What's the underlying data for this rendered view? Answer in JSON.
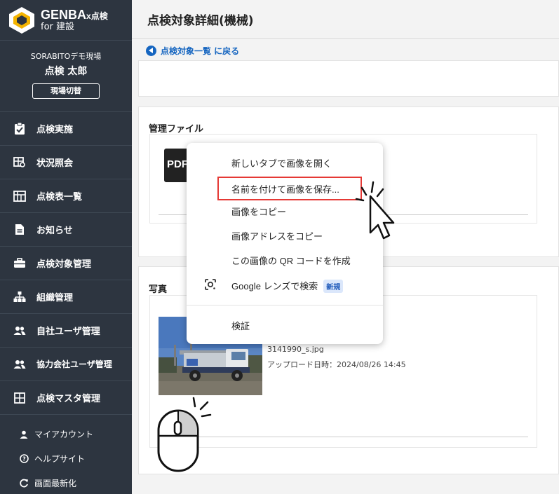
{
  "sidebar": {
    "brand_main": "GENBA",
    "brand_x": "x点検",
    "brand_sub": "for 建設",
    "site_name": "SORABITOデモ現場",
    "user_name": "点検 太郎",
    "switch_label": "現場切替",
    "nav": [
      {
        "label": "点検実施",
        "icon": "clipboard-check-icon"
      },
      {
        "label": "状況照会",
        "icon": "table-search-icon"
      },
      {
        "label": "点検表一覧",
        "icon": "table-list-icon"
      },
      {
        "label": "お知らせ",
        "icon": "document-icon"
      },
      {
        "label": "点検対象管理",
        "icon": "toolbox-icon"
      },
      {
        "label": "組織管理",
        "icon": "org-chart-icon"
      },
      {
        "label": "自社ユーザ管理",
        "icon": "users-icon"
      },
      {
        "label": "協力会社ユーザ管理",
        "icon": "users-icon"
      },
      {
        "label": "点検マスタ管理",
        "icon": "grid-icon"
      }
    ],
    "bottom": [
      {
        "label": "マイアカウント",
        "icon": "person-icon"
      },
      {
        "label": "ヘルプサイト",
        "icon": "help-circle-icon"
      },
      {
        "label": "画面最新化",
        "icon": "refresh-icon"
      }
    ]
  },
  "header": {
    "title": "点検対象詳細(機械)",
    "back_label": "点検対象一覧 に戻る"
  },
  "files": {
    "title": "管理ファイル",
    "pdf_label": "PDF"
  },
  "photos": {
    "title": "写真",
    "file_name": "3141990_s.jpg",
    "upload_date": "アップロード日時：2024/08/26 14:45"
  },
  "context_menu": {
    "items": [
      "新しいタブで画像を開く",
      "名前を付けて画像を保存...",
      "画像をコピー",
      "画像アドレスをコピー",
      "この画像の QR コードを作成",
      "Google レンズで検索"
    ],
    "badge": "新規",
    "inspect": "検証"
  },
  "colors": {
    "sidebar_bg": "#2d3540",
    "link": "#1565c0",
    "highlight": "#e53935"
  }
}
